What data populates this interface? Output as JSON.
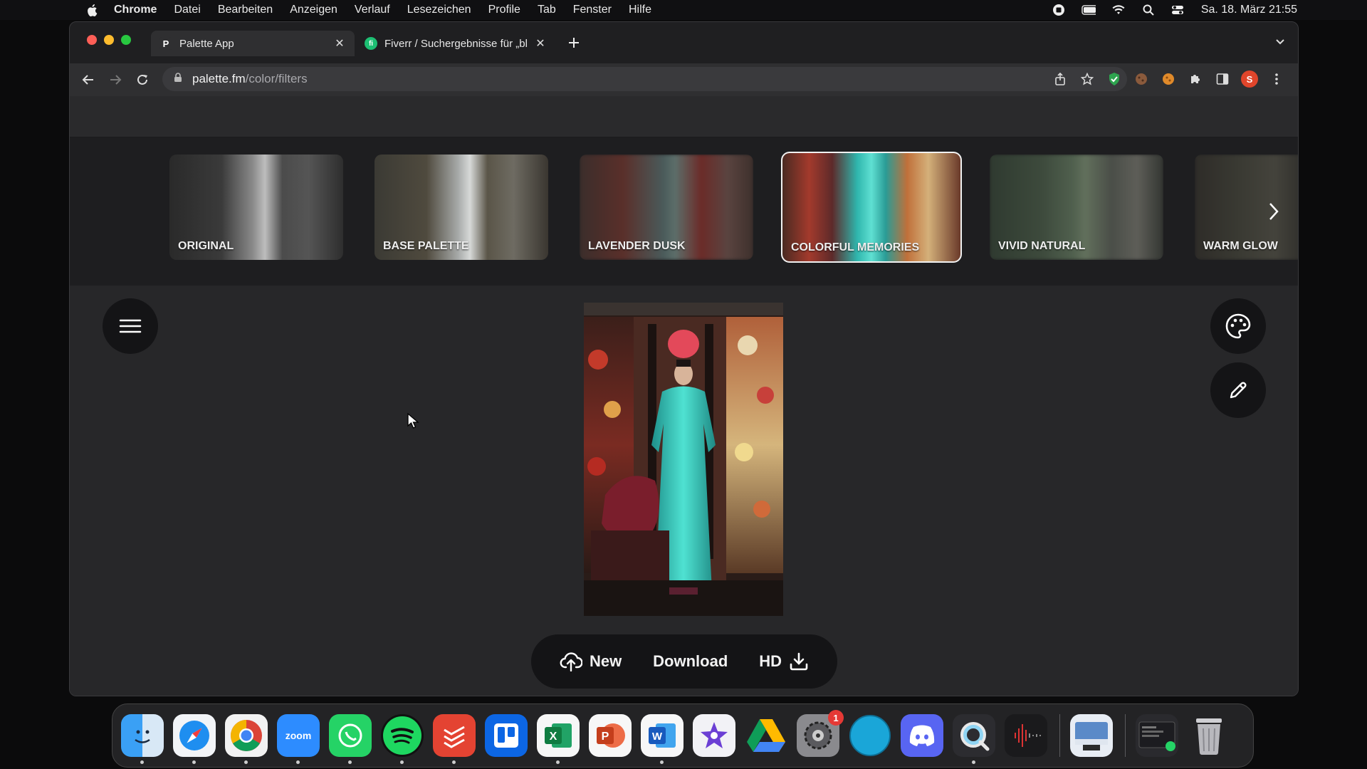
{
  "menubar": {
    "app_name": "Chrome",
    "menus": [
      "Datei",
      "Bearbeiten",
      "Anzeigen",
      "Verlauf",
      "Lesezeichen",
      "Profile",
      "Tab",
      "Fenster",
      "Hilfe"
    ],
    "clock": "Sa. 18. März 21:55"
  },
  "browser": {
    "tabs": [
      {
        "favicon": "P",
        "title": "Palette App",
        "active": true
      },
      {
        "favicon": "fi",
        "title": "Fiverr / Suchergebnisse für „bl",
        "active": false
      }
    ],
    "url_host": "palette.fm",
    "url_path": "/color/filters"
  },
  "filters": [
    {
      "label": "ORIGINAL"
    },
    {
      "label": "BASE PALETTE"
    },
    {
      "label": "LAVENDER DUSK"
    },
    {
      "label": "COLORFUL MEMORIES",
      "selected": true
    },
    {
      "label": "VIVID NATURAL"
    },
    {
      "label": "WARM GLOW"
    }
  ],
  "actions": {
    "new_label": "New",
    "download_label": "Download",
    "hd_label": "HD"
  },
  "dock": {
    "settings_badge": "1",
    "zoom_label": "zoom"
  },
  "colors": {
    "accent_selected": "#f1f1f1",
    "dress": "#3cc6b8",
    "badge": "#e53935"
  }
}
